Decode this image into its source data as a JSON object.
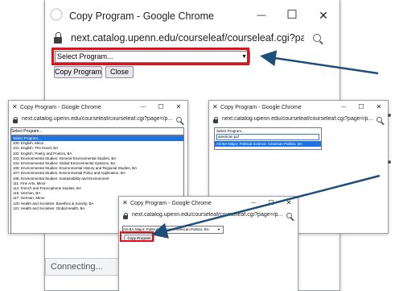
{
  "main_window": {
    "title": "Copy Program - Google Chrome",
    "url": "next.catalog.upenn.edu/courseleaf/courseleaf.cgi?page=/p...",
    "select_value": "Select Program...",
    "copy_button": "Copy Program",
    "close_button": "Close",
    "status": "Connecting..."
  },
  "list_window": {
    "title": "Copy Program - Google Chrome",
    "url": "next.catalog.upenn.edu/courseleaf/courseleaf.cgi?page=/p...",
    "select_value": "Select Program...",
    "options": [
      "Select Program...",
      "100: English, Minor",
      "101: English: The Novel, BA",
      "102: English: Poetry and Poetics, BA",
      "103: Environmental Studies: General Environmental Studies, BA",
      "104: Environmental Studies: Global Environmental Systems, BA",
      "105: Environmental Studies: Environmental History and Regional Studies, BA",
      "107: Environmental Studies: Environmental Policy and Application, BA",
      "108: Environmental Studies: Sustainability and Environment",
      "111: Fine Arts, Minor",
      "112: French and Francophone Studies, BA",
      "115: German, BA",
      "117: German, Minor",
      "120: Health and Societies: Bioethics & Society, BA",
      "121: Health and Societies: Global Health, BA"
    ],
    "selected_index": 0
  },
  "search_window": {
    "title": "Copy Program - Google Chrome",
    "url": "next.catalog.upenn.edu/courseleaf/courseleaf.cgi?page=/p...",
    "select_value": "Select Program...",
    "search_value": "american pol",
    "result": "AS-BA-Major: Political Science: American Politics, BA"
  },
  "result_window": {
    "title": "Copy Program - Google Chrome",
    "url": "next.catalog.upenn.edu/courseleaf/courseleaf.cgi?page=/p...",
    "select_value": "AS-BA-Major: Political Science: American Politics, BA",
    "copy_button": "Copy Program"
  },
  "icons": {
    "chrome_close": "✕",
    "minimize": "—",
    "maximize": "☐",
    "close": "✕",
    "dropdown": "▼"
  },
  "colors": {
    "highlight_box": "#e3101a",
    "arrow": "#1f4e79",
    "selected_option": "#1a73e8"
  }
}
